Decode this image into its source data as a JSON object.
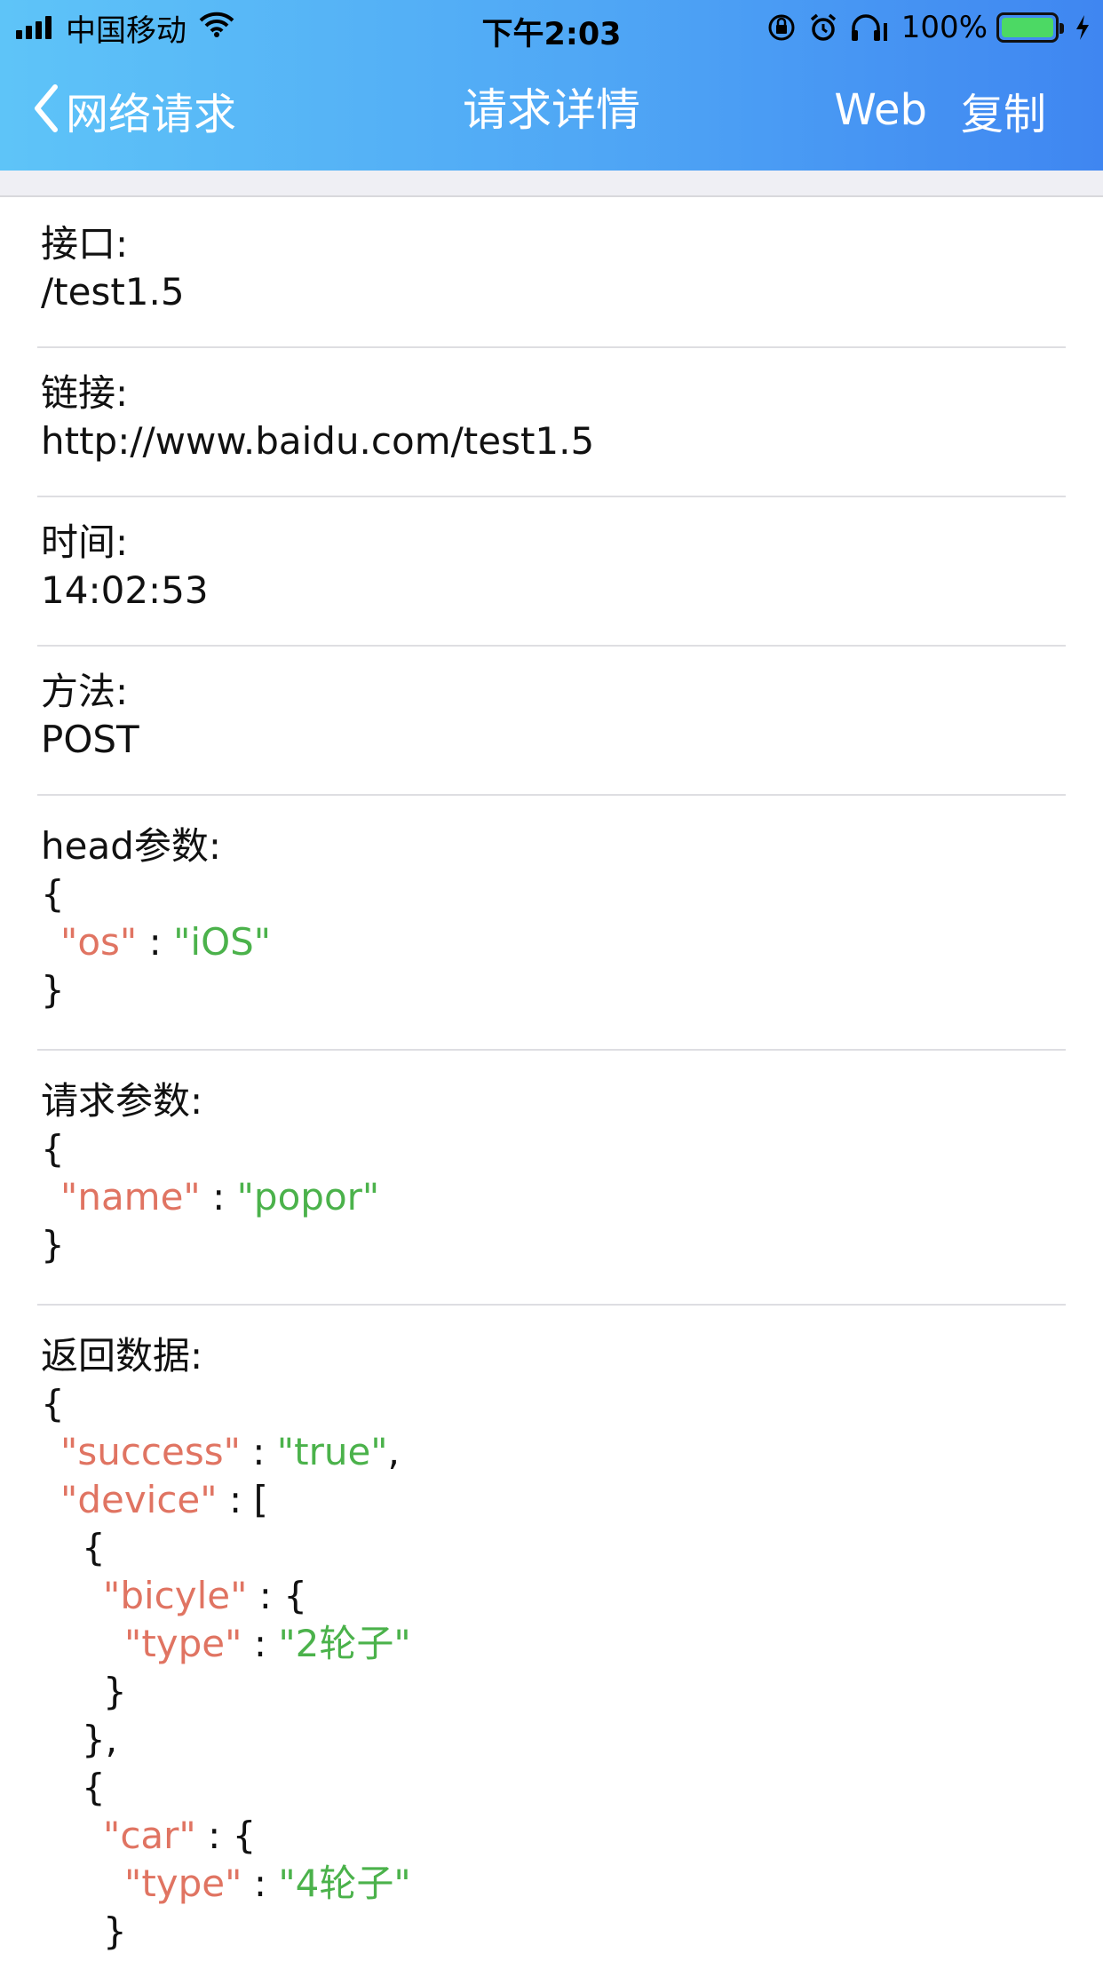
{
  "status_bar": {
    "carrier": "中国移动",
    "time": "下午2:03",
    "battery_percent": "100%",
    "battery_level": 1.0
  },
  "nav": {
    "back_label": "网络请求",
    "title": "请求详情",
    "web_button": "Web",
    "copy_button": "复制"
  },
  "details": {
    "api_label": "接口:",
    "api_value": "/test1.5",
    "url_label": "链接:",
    "url_value": "http://www.baidu.com/test1.5",
    "time_label": "时间:",
    "time_value": "14:02:53",
    "method_label": "方法:",
    "method_value": "POST",
    "head_label": "head参数:",
    "head_json": {
      "open": "{",
      "key": "\"os\"",
      "sep": " : ",
      "value": "\"iOS\"",
      "close": "}"
    },
    "request_label": "请求参数:",
    "request_json": {
      "open": "{",
      "key": "\"name\"",
      "sep": " : ",
      "value": "\"popor\"",
      "close": "}"
    },
    "response_label": "返回数据:",
    "response_json": {
      "open": "{",
      "success_key": "\"success\"",
      "success_sep": " : ",
      "success_value": "\"true\"",
      "success_comma": ",",
      "device_key": "\"device\"",
      "device_sep": " : [",
      "item1_open": "{",
      "bicyle_key": "\"bicyle\"",
      "bicyle_sep": " : {",
      "type1_key": "\"type\"",
      "type1_sep": " : ",
      "type1_value": "\"2轮子\"",
      "bicyle_close": "}",
      "item1_close": "},",
      "item2_open": "{",
      "car_key": "\"car\"",
      "car_sep": " : {",
      "type2_key": "\"type\"",
      "type2_sep": " : ",
      "type2_value": "\"4轮子\"",
      "car_close": "}"
    }
  },
  "colors": {
    "json_key": "#e07462",
    "json_string": "#4bb24b",
    "header_gradient_start": "#5ec4f8",
    "header_gradient_end": "#3f86f1"
  }
}
